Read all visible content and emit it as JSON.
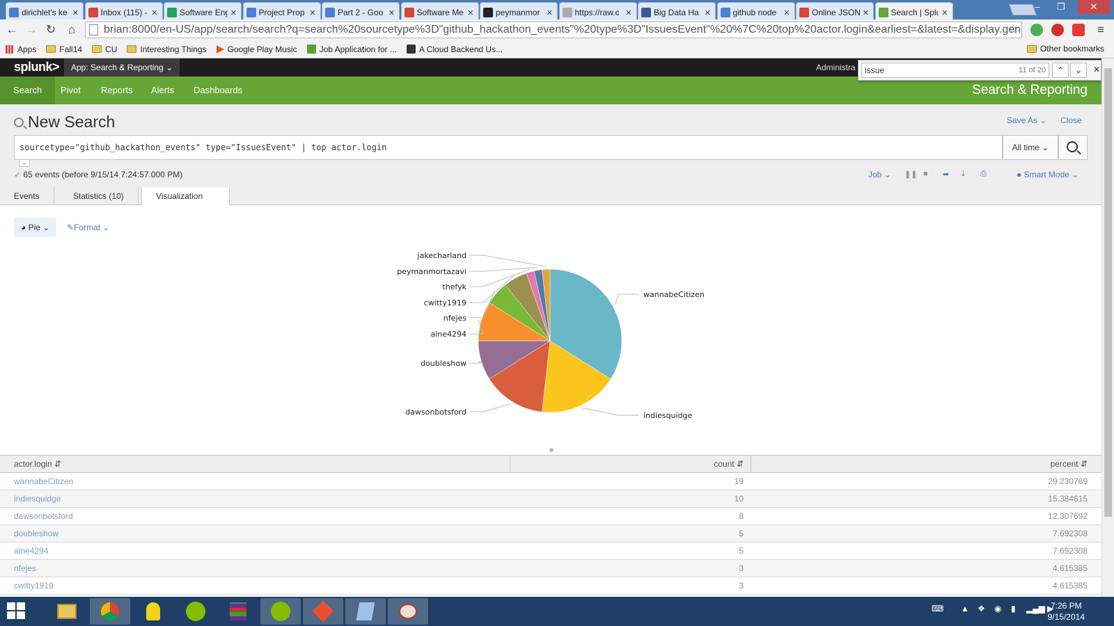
{
  "browser": {
    "tabs": [
      {
        "title": "dirichlet's ke",
        "color": "#4a7fd4"
      },
      {
        "title": "Inbox (115) -",
        "color": "#d44638"
      },
      {
        "title": "Software Eng",
        "color": "#1fa463"
      },
      {
        "title": "Project Prop",
        "color": "#4a7fd4"
      },
      {
        "title": "Part 2 - Goo",
        "color": "#4a7fd4"
      },
      {
        "title": "Software Me",
        "color": "#d44638"
      },
      {
        "title": "peymanmor",
        "color": "#222222"
      },
      {
        "title": "https://raw.c",
        "color": "#aaaaaa"
      },
      {
        "title": "Big Data Ha",
        "color": "#3b5998"
      },
      {
        "title": "github node",
        "color": "#4a7fd4"
      },
      {
        "title": "Online JSON",
        "color": "#d44638"
      },
      {
        "title": "Search | Splu",
        "color": "#65a637",
        "active": true
      }
    ],
    "url": "brian:8000/en-US/app/search/search?q=search%20sourcetype%3D\"github_hackathon_events\"%20type%3D\"IssuesEvent\"%20%7C%20top%20actor.login&earliest=&latest=&display.gene",
    "bookmarks": [
      "Apps",
      "Fall14",
      "CU",
      "Interesting Things",
      "Google Play Music",
      "Job Application for ...",
      "A Cloud Backend Us..."
    ],
    "other_bookmarks": "Other bookmarks",
    "find": {
      "query": "issue",
      "count": "11 of 20"
    }
  },
  "splunk": {
    "logo": "splunk>",
    "app_menu": "App: Search & Reporting",
    "admin": "Administra",
    "nav": [
      "Search",
      "Pivot",
      "Reports",
      "Alerts",
      "Dashboards"
    ],
    "app_title": "Search & Reporting",
    "page_title": "New Search",
    "save_as": "Save As",
    "close": "Close",
    "query": "sourcetype=\"github_hackathon_events\" type=\"IssuesEvent\" | top actor.login",
    "time_range": "All time",
    "status": "65 events (before 9/15/14 7:24:57.000 PM)",
    "job": "Job",
    "smart_mode": "Smart Mode",
    "tabs": [
      "Events",
      "Statistics (10)",
      "Visualization"
    ],
    "viz_type": "Pie",
    "format": "Format"
  },
  "chart_data": {
    "type": "pie",
    "slices": [
      {
        "label": "wannabeCitizen",
        "value": 19,
        "color": "#6ab7c7"
      },
      {
        "label": "indiesquidge",
        "value": 10,
        "color": "#fac61d"
      },
      {
        "label": "dawsonbotsford",
        "value": 8,
        "color": "#d85e3d"
      },
      {
        "label": "doubleshow",
        "value": 5,
        "color": "#956e96"
      },
      {
        "label": "alne4294",
        "value": 5,
        "color": "#f7902b"
      },
      {
        "label": "nfejes",
        "value": 3,
        "color": "#7ab937"
      },
      {
        "label": "cwitty1919",
        "value": 3,
        "color": "#9d8f4f"
      },
      {
        "label": "thefyk",
        "value": 1,
        "color": "#e379a9"
      },
      {
        "label": "peymanmortazavi",
        "value": 1,
        "color": "#4f7bb7"
      },
      {
        "label": "jakecharland",
        "value": 1,
        "color": "#e0a63a"
      }
    ]
  },
  "table": {
    "columns": [
      "actor.login",
      "count",
      "percent"
    ],
    "rows": [
      [
        "wannabeCitizen",
        "19",
        "29.230769"
      ],
      [
        "indiesquidge",
        "10",
        "15.384615"
      ],
      [
        "dawsonbotsford",
        "8",
        "12.307692"
      ],
      [
        "doubleshow",
        "5",
        "7.692308"
      ],
      [
        "alne4294",
        "5",
        "7.692308"
      ],
      [
        "nfejes",
        "3",
        "4.615385"
      ],
      [
        "cwitty1919",
        "3",
        "4.615385"
      ]
    ]
  },
  "taskbar": {
    "time": "7:26 PM",
    "date": "9/15/2014"
  }
}
